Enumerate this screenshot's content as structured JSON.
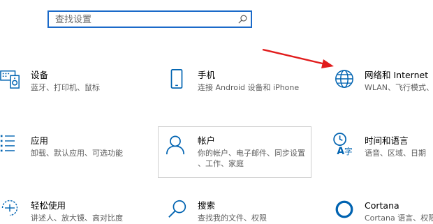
{
  "search": {
    "placeholder": "查找设置"
  },
  "tiles": [
    {
      "icon": "device-icon",
      "title": "设备",
      "desc": [
        "蓝牙、打印机、鼠标"
      ]
    },
    {
      "icon": "phone-icon",
      "title": "手机",
      "desc": [
        "连接 Android 设备和 iPhone"
      ]
    },
    {
      "icon": "globe-icon",
      "title": "网络和 Internet",
      "desc": [
        "WLAN、飞行模式、"
      ]
    },
    {
      "icon": "apps-icon",
      "title": "应用",
      "desc": [
        "卸载、默认应用、可选功能"
      ]
    },
    {
      "icon": "person-icon",
      "title": "帐户",
      "desc": [
        "你的帐户、电子邮件、同步设置",
        "、工作、家庭"
      ]
    },
    {
      "icon": "time-language-icon",
      "title": "时间和语言",
      "desc": [
        "语音、区域、日期"
      ]
    },
    {
      "icon": "ease-of-access-icon",
      "title": "轻松使用",
      "desc": [
        "讲述人、放大镜、高对比度"
      ]
    },
    {
      "icon": "search-icon",
      "title": "搜索",
      "desc": [
        "查找我的文件、权限"
      ]
    },
    {
      "icon": "cortana-icon",
      "title": "Cortana",
      "desc": [
        "Cortana 语言、权限"
      ]
    }
  ],
  "colors": {
    "accent": "#0063b1",
    "search_border": "#1b6ac9",
    "annotation_arrow": "#e11b1b",
    "selected_border": "#cfcfcf"
  }
}
